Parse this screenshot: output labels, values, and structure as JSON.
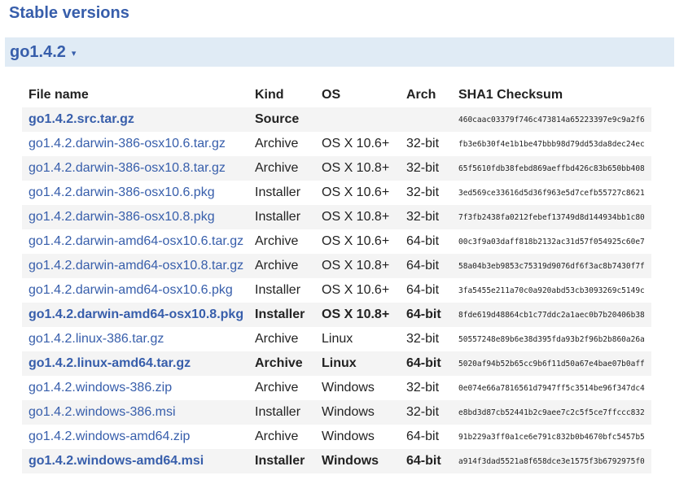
{
  "page": {
    "heading": "Stable versions"
  },
  "release": {
    "title": "go1.4.2",
    "toggle_icon": "caret-down-icon",
    "caret": "▾"
  },
  "table": {
    "headers": {
      "file": "File name",
      "kind": "Kind",
      "os": "OS",
      "arch": "Arch",
      "sha": "SHA1 Checksum"
    },
    "rows": [
      {
        "file": "go1.4.2.src.tar.gz",
        "kind": "Source",
        "os": "",
        "arch": "",
        "sha": "460caac03379f746c473814a65223397e9c9a2f6",
        "highlight": true
      },
      {
        "file": "go1.4.2.darwin-386-osx10.6.tar.gz",
        "kind": "Archive",
        "os": "OS X 10.6+",
        "arch": "32-bit",
        "sha": "fb3e6b30f4e1b1be47bbb98d79dd53da8dec24ec",
        "highlight": false
      },
      {
        "file": "go1.4.2.darwin-386-osx10.8.tar.gz",
        "kind": "Archive",
        "os": "OS X 10.8+",
        "arch": "32-bit",
        "sha": "65f5610fdb38febd869aeffbd426c83b650bb408",
        "highlight": false
      },
      {
        "file": "go1.4.2.darwin-386-osx10.6.pkg",
        "kind": "Installer",
        "os": "OS X 10.6+",
        "arch": "32-bit",
        "sha": "3ed569ce33616d5d36f963e5d7cefb55727c8621",
        "highlight": false
      },
      {
        "file": "go1.4.2.darwin-386-osx10.8.pkg",
        "kind": "Installer",
        "os": "OS X 10.8+",
        "arch": "32-bit",
        "sha": "7f3fb2438fa0212febef13749d8d144934bb1c80",
        "highlight": false
      },
      {
        "file": "go1.4.2.darwin-amd64-osx10.6.tar.gz",
        "kind": "Archive",
        "os": "OS X 10.6+",
        "arch": "64-bit",
        "sha": "00c3f9a03daff818b2132ac31d57f054925c60e7",
        "highlight": false
      },
      {
        "file": "go1.4.2.darwin-amd64-osx10.8.tar.gz",
        "kind": "Archive",
        "os": "OS X 10.8+",
        "arch": "64-bit",
        "sha": "58a04b3eb9853c75319d9076df6f3ac8b7430f7f",
        "highlight": false
      },
      {
        "file": "go1.4.2.darwin-amd64-osx10.6.pkg",
        "kind": "Installer",
        "os": "OS X 10.6+",
        "arch": "64-bit",
        "sha": "3fa5455e211a70c0a920abd53cb3093269c5149c",
        "highlight": false
      },
      {
        "file": "go1.4.2.darwin-amd64-osx10.8.pkg",
        "kind": "Installer",
        "os": "OS X 10.8+",
        "arch": "64-bit",
        "sha": "8fde619d48864cb1c77ddc2a1aec0b7b20406b38",
        "highlight": true
      },
      {
        "file": "go1.4.2.linux-386.tar.gz",
        "kind": "Archive",
        "os": "Linux",
        "arch": "32-bit",
        "sha": "50557248e89b6e38d395fda93b2f96b2b860a26a",
        "highlight": false
      },
      {
        "file": "go1.4.2.linux-amd64.tar.gz",
        "kind": "Archive",
        "os": "Linux",
        "arch": "64-bit",
        "sha": "5020af94b52b65cc9b6f11d50a67e4bae07b0aff",
        "highlight": true
      },
      {
        "file": "go1.4.2.windows-386.zip",
        "kind": "Archive",
        "os": "Windows",
        "arch": "32-bit",
        "sha": "0e074e66a7816561d7947ff5c3514be96f347dc4",
        "highlight": false
      },
      {
        "file": "go1.4.2.windows-386.msi",
        "kind": "Installer",
        "os": "Windows",
        "arch": "32-bit",
        "sha": "e8bd3d87cb52441b2c9aee7c2c5f5ce7ffccc832",
        "highlight": false
      },
      {
        "file": "go1.4.2.windows-amd64.zip",
        "kind": "Archive",
        "os": "Windows",
        "arch": "64-bit",
        "sha": "91b229a3ff0a1ce6e791c832b0b4670bfc5457b5",
        "highlight": false
      },
      {
        "file": "go1.4.2.windows-amd64.msi",
        "kind": "Installer",
        "os": "Windows",
        "arch": "64-bit",
        "sha": "a914f3dad5521a8f658dce3e1575f3b6792975f0",
        "highlight": true
      }
    ]
  },
  "colors": {
    "link": "#375eab",
    "release_bar_bg": "#e0ebf5",
    "row_stripe": "#f4f4f4"
  }
}
